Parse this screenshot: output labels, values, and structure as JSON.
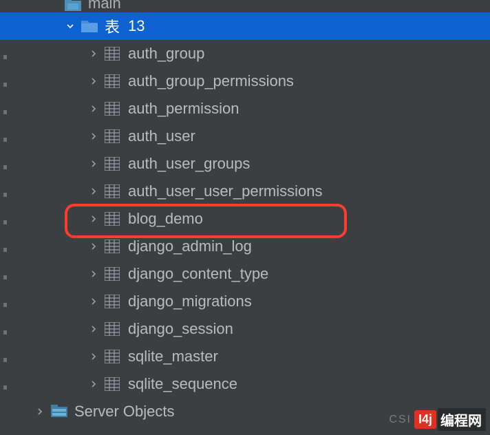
{
  "truncated_parent": {
    "label": "main"
  },
  "folder": {
    "label": "表",
    "count": "13"
  },
  "tables": [
    {
      "label": "auth_group"
    },
    {
      "label": "auth_group_permissions"
    },
    {
      "label": "auth_permission"
    },
    {
      "label": "auth_user"
    },
    {
      "label": "auth_user_groups"
    },
    {
      "label": "auth_user_user_permissions"
    },
    {
      "label": "blog_demo"
    },
    {
      "label": "django_admin_log"
    },
    {
      "label": "django_content_type"
    },
    {
      "label": "django_migrations"
    },
    {
      "label": "django_session"
    },
    {
      "label": "sqlite_master"
    },
    {
      "label": "sqlite_sequence"
    }
  ],
  "server_objects": {
    "label": "Server Objects"
  },
  "watermark": {
    "csdn": "CSI",
    "badge": "I4j",
    "text": "编程网"
  }
}
